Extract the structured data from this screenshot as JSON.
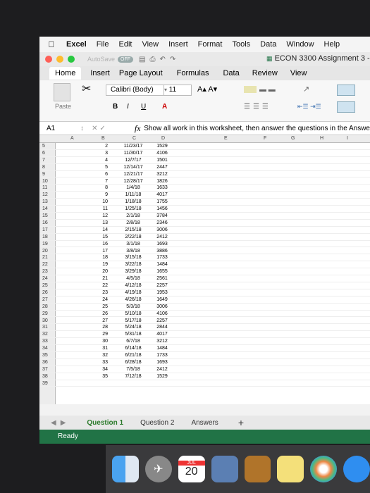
{
  "menubar": {
    "app_name": "Excel",
    "items": [
      "File",
      "Edit",
      "View",
      "Insert",
      "Format",
      "Tools",
      "Data",
      "Window",
      "Help"
    ]
  },
  "titlebar": {
    "autosave_label": "AutoSave",
    "autosave_state": "OFF",
    "document_title": "ECON 3300 Assignment 3 -"
  },
  "ribbon_tabs": [
    "Home",
    "Insert",
    "Page Layout",
    "Formulas",
    "Data",
    "Review",
    "View"
  ],
  "ribbon": {
    "paste_label": "Paste",
    "font_name": "Calibri (Body)",
    "font_size": "11",
    "grow_shrink": "A▴ A▾",
    "bold": "B",
    "italic": "I",
    "underline": "U"
  },
  "formula_bar": {
    "cell_ref": "A1",
    "fx": "fx",
    "content": "Show all work in this worksheet, then answer the questions in the Answe"
  },
  "columns": [
    "A",
    "B",
    "C",
    "D",
    "E",
    "F",
    "G",
    "H",
    "I"
  ],
  "rows": [
    {
      "n": "5",
      "b": "2",
      "c": "11/23/17",
      "d": "1529"
    },
    {
      "n": "6",
      "b": "3",
      "c": "11/30/17",
      "d": "4106"
    },
    {
      "n": "7",
      "b": "4",
      "c": "12/7/17",
      "d": "1501"
    },
    {
      "n": "8",
      "b": "5",
      "c": "12/14/17",
      "d": "2447"
    },
    {
      "n": "9",
      "b": "6",
      "c": "12/21/17",
      "d": "3212"
    },
    {
      "n": "10",
      "b": "7",
      "c": "12/28/17",
      "d": "1826"
    },
    {
      "n": "11",
      "b": "8",
      "c": "1/4/18",
      "d": "1633"
    },
    {
      "n": "12",
      "b": "9",
      "c": "1/11/18",
      "d": "4017"
    },
    {
      "n": "13",
      "b": "10",
      "c": "1/18/18",
      "d": "1755"
    },
    {
      "n": "14",
      "b": "11",
      "c": "1/25/18",
      "d": "1456"
    },
    {
      "n": "15",
      "b": "12",
      "c": "2/1/18",
      "d": "3784"
    },
    {
      "n": "16",
      "b": "13",
      "c": "2/8/18",
      "d": "2346"
    },
    {
      "n": "17",
      "b": "14",
      "c": "2/15/18",
      "d": "3006"
    },
    {
      "n": "18",
      "b": "15",
      "c": "2/22/18",
      "d": "2412"
    },
    {
      "n": "19",
      "b": "16",
      "c": "3/1/18",
      "d": "1693"
    },
    {
      "n": "20",
      "b": "17",
      "c": "3/8/18",
      "d": "3886"
    },
    {
      "n": "21",
      "b": "18",
      "c": "3/15/18",
      "d": "1733"
    },
    {
      "n": "22",
      "b": "19",
      "c": "3/22/18",
      "d": "1484"
    },
    {
      "n": "23",
      "b": "20",
      "c": "3/29/18",
      "d": "1655"
    },
    {
      "n": "24",
      "b": "21",
      "c": "4/5/18",
      "d": "2561"
    },
    {
      "n": "25",
      "b": "22",
      "c": "4/12/18",
      "d": "2257"
    },
    {
      "n": "26",
      "b": "23",
      "c": "4/19/18",
      "d": "1953"
    },
    {
      "n": "27",
      "b": "24",
      "c": "4/26/18",
      "d": "1649"
    },
    {
      "n": "28",
      "b": "25",
      "c": "5/3/18",
      "d": "3006"
    },
    {
      "n": "29",
      "b": "26",
      "c": "5/10/18",
      "d": "4106"
    },
    {
      "n": "30",
      "b": "27",
      "c": "5/17/18",
      "d": "2257"
    },
    {
      "n": "31",
      "b": "28",
      "c": "5/24/18",
      "d": "2844"
    },
    {
      "n": "32",
      "b": "29",
      "c": "5/31/18",
      "d": "4017"
    },
    {
      "n": "33",
      "b": "30",
      "c": "6/7/18",
      "d": "3212"
    },
    {
      "n": "34",
      "b": "31",
      "c": "6/14/18",
      "d": "1484"
    },
    {
      "n": "35",
      "b": "32",
      "c": "6/21/18",
      "d": "1733"
    },
    {
      "n": "36",
      "b": "33",
      "c": "6/28/18",
      "d": "1693"
    },
    {
      "n": "37",
      "b": "34",
      "c": "7/5/18",
      "d": "2412"
    },
    {
      "n": "38",
      "b": "35",
      "c": "7/12/18",
      "d": "1529"
    },
    {
      "n": "39",
      "b": "",
      "c": "",
      "d": ""
    }
  ],
  "sheet_tabs": [
    "Question 1",
    "Question 2",
    "Answers"
  ],
  "status": "Ready",
  "dock": {
    "calendar_month": "JUL",
    "calendar_day": "20"
  },
  "colors": {
    "status_green": "#217346",
    "active_tab_green": "#2a7a2a",
    "close_light": "#fe5f57",
    "minimize_light": "#febc2e",
    "zoom_light": "#28c840"
  }
}
